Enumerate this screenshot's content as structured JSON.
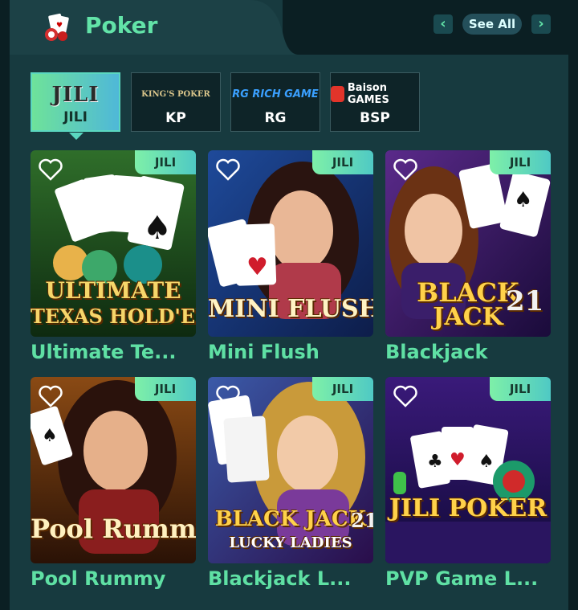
{
  "header": {
    "title": "Poker",
    "see_all": "See All",
    "prev": "‹",
    "next": "›"
  },
  "providers": [
    {
      "logo": "JILI",
      "label": "JILI",
      "active": true
    },
    {
      "logo": "KING'S POKER",
      "label": "KP",
      "active": false
    },
    {
      "logo": "RG RICH GAME",
      "label": "RG",
      "active": false
    },
    {
      "logo": "Baison GAMES",
      "label": "BSP",
      "active": false
    }
  ],
  "games": [
    {
      "title": "Ultimate Te...",
      "badge": "JILI",
      "art": [
        "ULTIMATE",
        "TEXAS HOLD'EM"
      ]
    },
    {
      "title": "Mini Flush",
      "badge": "JILI",
      "art": [
        "MINI FLUSH"
      ]
    },
    {
      "title": "Blackjack",
      "badge": "JILI",
      "art": [
        "BLACK",
        "JACK",
        "21"
      ]
    },
    {
      "title": "Pool Rummy",
      "badge": "JILI",
      "art": [
        "Pool Rummy"
      ]
    },
    {
      "title": "Blackjack L...",
      "badge": "JILI",
      "art": [
        "BLACK JACK",
        "LUCKY LADIES",
        "21"
      ]
    },
    {
      "title": "PVP Game L...",
      "badge": "JILI",
      "art": [
        "JILI POKER"
      ]
    }
  ],
  "colors": {
    "accent": "#62e3a8",
    "panel": "#173a3f",
    "badge": "#7ef0a8"
  }
}
